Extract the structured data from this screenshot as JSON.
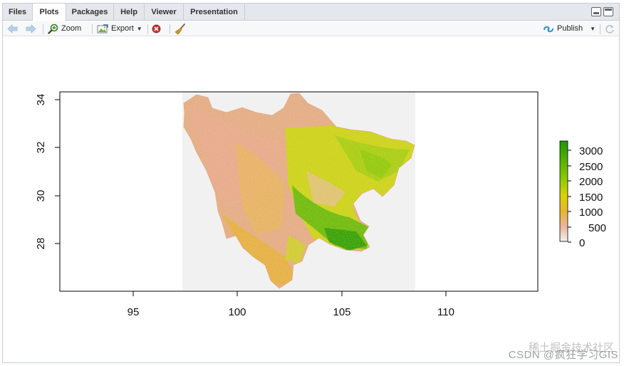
{
  "tabs": [
    {
      "label": "Files",
      "active": false
    },
    {
      "label": "Plots",
      "active": true
    },
    {
      "label": "Packages",
      "active": false
    },
    {
      "label": "Help",
      "active": false
    },
    {
      "label": "Viewer",
      "active": false
    },
    {
      "label": "Presentation",
      "active": false
    }
  ],
  "toolbar": {
    "zoom_label": "Zoom",
    "export_label": "Export",
    "publish_label": "Publish"
  },
  "plot": {
    "x_ticks": [
      "95",
      "100",
      "105",
      "110"
    ],
    "y_ticks": [
      "34",
      "32",
      "30",
      "28"
    ],
    "legend_ticks": [
      "3000",
      "2500",
      "2000",
      "1500",
      "1000",
      "500",
      "0"
    ]
  },
  "chart_data": {
    "type": "heatmap",
    "title": "",
    "xlabel": "",
    "ylabel": "",
    "x_ticks": [
      95,
      100,
      105,
      110
    ],
    "y_ticks": [
      28,
      30,
      32,
      34
    ],
    "xlim": [
      91.6,
      114.7
    ],
    "ylim": [
      26.0,
      34.4
    ],
    "raster_extent": {
      "x": [
        97.4,
        108.5
      ],
      "y": [
        26.0,
        34.4
      ]
    },
    "colorbar": {
      "range": [
        0,
        3300
      ],
      "ticks": [
        0,
        500,
        1000,
        1500,
        2000,
        2500,
        3000
      ],
      "colors": [
        "#f2f2f2",
        "#ebb59a",
        "#e8b52d",
        "#dbd207",
        "#8ccb03",
        "#1d9605"
      ]
    },
    "grid": false,
    "legend": "right"
  },
  "watermark": {
    "text": "CSDN @疯狂学习GIS",
    "overlay": "稀土掘金技术社区"
  }
}
